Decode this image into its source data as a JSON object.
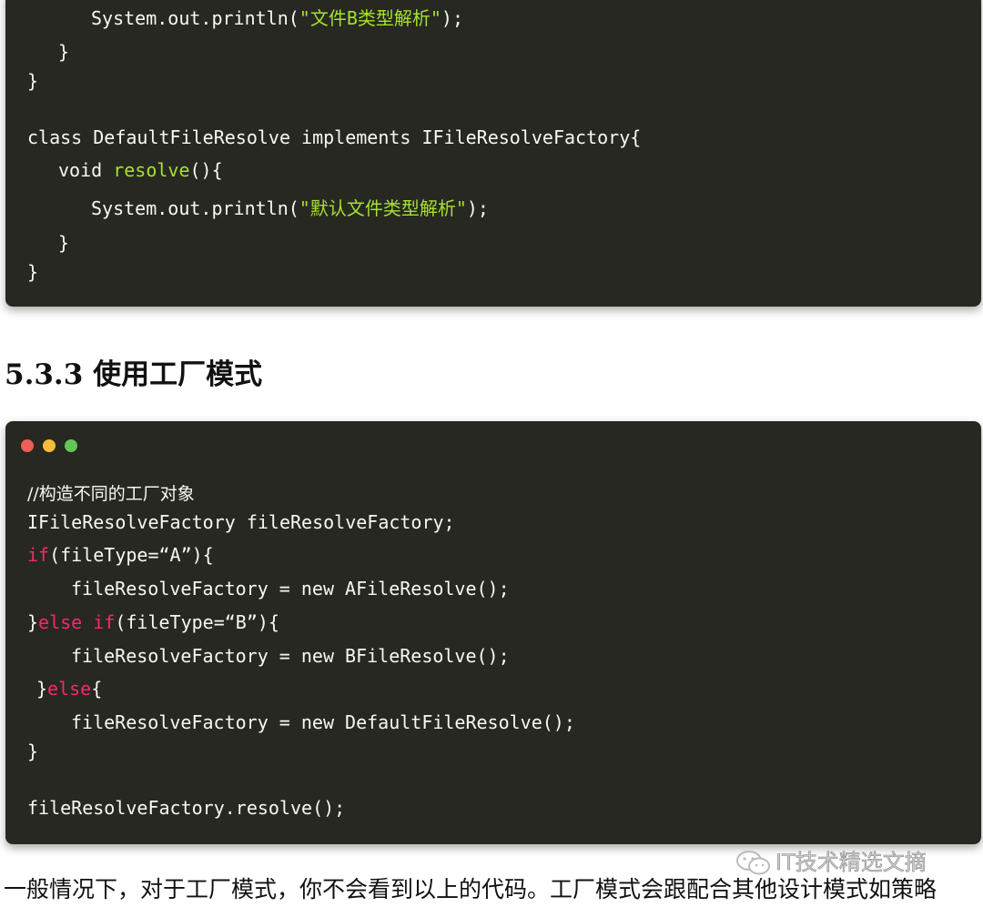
{
  "block1": {
    "l1_pre": "System.out.println(",
    "l1_str": "\"文件B类型解析\"",
    "l1_post": ");",
    "l2": "}",
    "l3": "}",
    "l4": "class DefaultFileResolve implements IFileResolveFactory{",
    "l5_pre": "void ",
    "l5_fn": "resolve",
    "l5_post": "(){",
    "l6_pre": "System.out.println(",
    "l6_str": "\"默认文件类型解析\"",
    "l6_post": ");",
    "l7": "}",
    "l8": "}"
  },
  "heading": "5.3.3 使用工厂模式",
  "window_dots": {
    "red": "#ee5f57",
    "yellow": "#f6bd3b",
    "green": "#62c655"
  },
  "block2": {
    "c1": "//构造不同的工厂对象",
    "c2": "IFileResolveFactory fileResolveFactory;",
    "c3_kw": "if",
    "c3_rest": "(fileType=“A”){",
    "c4": "fileResolveFactory = new AFileResolve();",
    "c5_pre": "}",
    "c5_kw1": "else if",
    "c5_rest": "(fileType=“B”){",
    "c6": "fileResolveFactory = new BFileResolve();",
    "c7_pre": "}",
    "c7_kw": "else",
    "c7_rest": "{",
    "c8": "fileResolveFactory = new DefaultFileResolve();",
    "c9": "}",
    "c10": "fileResolveFactory.resolve();"
  },
  "watermark": {
    "icon": "wechat-icon",
    "text": "IT技术精选文摘"
  },
  "paragraph": "一般情况下，对于工厂模式，你不会看到以上的代码。工厂模式会跟配合其他设计模式如策略"
}
